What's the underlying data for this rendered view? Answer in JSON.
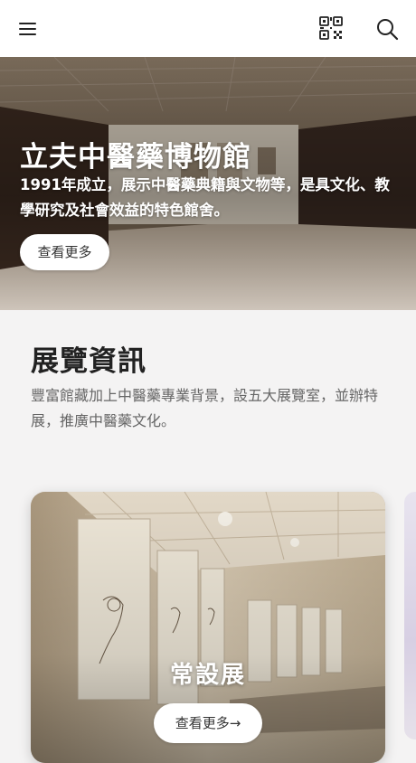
{
  "header": {
    "menu_icon": "hamburger-menu-icon",
    "qr_icon": "qr-code-icon",
    "search_icon": "search-icon"
  },
  "hero": {
    "title": "立夫中醫藥博物館",
    "description": "1991年成立，展示中醫藥典籍與文物等，是具文化、教學研究及社會效益的特色館舍。",
    "button_label": "查看更多"
  },
  "info": {
    "title": "展覽資訊",
    "description": "豐富館藏加上中醫藥專業背景，設五大展覽室，並辦特展，推廣中醫藥文化。"
  },
  "cards": [
    {
      "title": "常設展",
      "button_label": "查看更多→"
    }
  ],
  "colors": {
    "topbar_bg": "#ffffff",
    "page_bg": "#f4f3f3",
    "button_bg": "#ffffff"
  }
}
